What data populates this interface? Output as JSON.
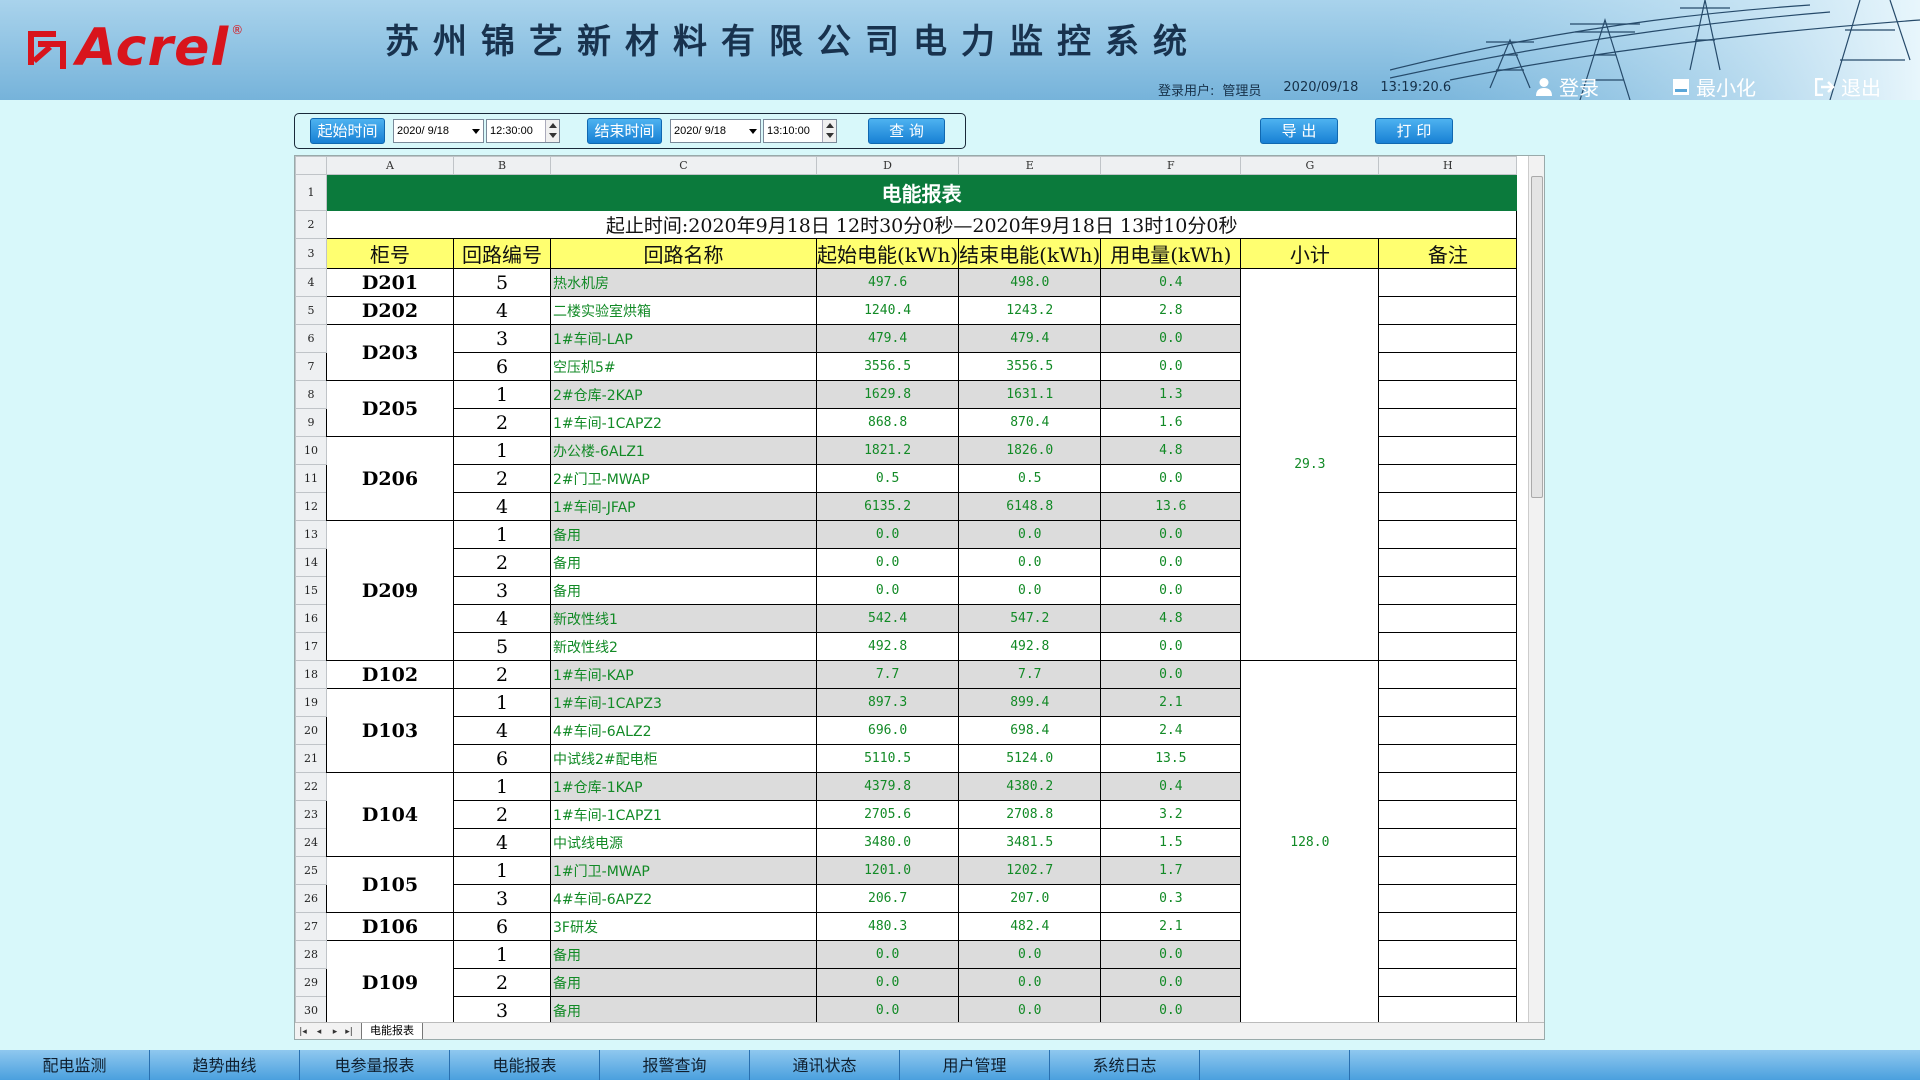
{
  "header": {
    "logo_text": "Acrel",
    "logo_reg": "®",
    "title": "苏州锦艺新材料有限公司电力监控系统",
    "user_label": "登录用户:",
    "user_name": "管理员",
    "date": "2020/09/18",
    "time": "13:19:20.6",
    "buttons": {
      "login": "登录",
      "minimize": "最小化",
      "exit": "退出"
    }
  },
  "filter": {
    "start_label": "起始时间",
    "start_date": "2020/ 9/18",
    "start_time": "12:30:00",
    "end_label": "结束时间",
    "end_date": "2020/ 9/18",
    "end_time": "13:10:00",
    "query": "查 询",
    "export": "导 出",
    "print": "打 印"
  },
  "sheet": {
    "columns": [
      "A",
      "B",
      "C",
      "D",
      "E",
      "F",
      "G",
      "H"
    ],
    "title": "电能报表",
    "time_range": "起止时间:2020年9月18日 12时30分0秒—2020年9月18日 13时10分0秒",
    "headers": [
      "柜号",
      "回路编号",
      "回路名称",
      "起始电能(kWh)",
      "结束电能(kWh)",
      "用电量(kWh)",
      "小计",
      "备注"
    ],
    "tab_name": "电能报表",
    "rows": [
      {
        "r": "4",
        "cab": "D201",
        "loop": "5",
        "name": "热水机房",
        "start": "497.6",
        "end": "498.0",
        "use": "0.4"
      },
      {
        "r": "5",
        "cab": "D202",
        "loop": "4",
        "name": "二楼实验室烘箱",
        "start": "1240.4",
        "end": "1243.2",
        "use": "2.8"
      },
      {
        "r": "6",
        "cab": "D203",
        "loop": "3",
        "name": "1#车间-LAP",
        "start": "479.4",
        "end": "479.4",
        "use": "0.0"
      },
      {
        "r": "7",
        "cab": "",
        "loop": "6",
        "name": "空压机5#",
        "start": "3556.5",
        "end": "3556.5",
        "use": "0.0"
      },
      {
        "r": "8",
        "cab": "D205",
        "loop": "1",
        "name": "2#仓库-2KAP",
        "start": "1629.8",
        "end": "1631.1",
        "use": "1.3"
      },
      {
        "r": "9",
        "cab": "",
        "loop": "2",
        "name": "1#车间-1CAPZ2",
        "start": "868.8",
        "end": "870.4",
        "use": "1.6"
      },
      {
        "r": "10",
        "cab": "D206",
        "loop": "1",
        "name": "办公楼-6ALZ1",
        "start": "1821.2",
        "end": "1826.0",
        "use": "4.8"
      },
      {
        "r": "11",
        "cab": "",
        "loop": "2",
        "name": "2#门卫-MWAP",
        "start": "0.5",
        "end": "0.5",
        "use": "0.0"
      },
      {
        "r": "12",
        "cab": "",
        "loop": "4",
        "name": "1#车间-JFAP",
        "start": "6135.2",
        "end": "6148.8",
        "use": "13.6"
      },
      {
        "r": "13",
        "cab": "D209",
        "loop": "1",
        "name": "备用",
        "start": "0.0",
        "end": "0.0",
        "use": "0.0"
      },
      {
        "r": "14",
        "cab": "",
        "loop": "2",
        "name": "备用",
        "start": "0.0",
        "end": "0.0",
        "use": "0.0"
      },
      {
        "r": "15",
        "cab": "",
        "loop": "3",
        "name": "备用",
        "start": "0.0",
        "end": "0.0",
        "use": "0.0"
      },
      {
        "r": "16",
        "cab": "",
        "loop": "4",
        "name": "新改性线1",
        "start": "542.4",
        "end": "547.2",
        "use": "4.8"
      },
      {
        "r": "17",
        "cab": "",
        "loop": "5",
        "name": "新改性线2",
        "start": "492.8",
        "end": "492.8",
        "use": "0.0"
      },
      {
        "r": "18",
        "cab": "D102",
        "loop": "2",
        "name": "1#车间-KAP",
        "start": "7.7",
        "end": "7.7",
        "use": "0.0"
      },
      {
        "r": "19",
        "cab": "D103",
        "loop": "1",
        "name": "1#车间-1CAPZ3",
        "start": "897.3",
        "end": "899.4",
        "use": "2.1"
      },
      {
        "r": "20",
        "cab": "",
        "loop": "4",
        "name": "4#车间-6ALZ2",
        "start": "696.0",
        "end": "698.4",
        "use": "2.4"
      },
      {
        "r": "21",
        "cab": "",
        "loop": "6",
        "name": "中试线2#配电柜",
        "start": "5110.5",
        "end": "5124.0",
        "use": "13.5"
      },
      {
        "r": "22",
        "cab": "D104",
        "loop": "1",
        "name": "1#仓库-1KAP",
        "start": "4379.8",
        "end": "4380.2",
        "use": "0.4"
      },
      {
        "r": "23",
        "cab": "",
        "loop": "2",
        "name": "1#车间-1CAPZ1",
        "start": "2705.6",
        "end": "2708.8",
        "use": "3.2"
      },
      {
        "r": "24",
        "cab": "",
        "loop": "4",
        "name": "中试线电源",
        "start": "3480.0",
        "end": "3481.5",
        "use": "1.5"
      },
      {
        "r": "25",
        "cab": "D105",
        "loop": "1",
        "name": "1#门卫-MWAP",
        "start": "1201.0",
        "end": "1202.7",
        "use": "1.7"
      },
      {
        "r": "26",
        "cab": "",
        "loop": "3",
        "name": "4#车间-6APZ2",
        "start": "206.7",
        "end": "207.0",
        "use": "0.3"
      },
      {
        "r": "27",
        "cab": "D106",
        "loop": "6",
        "name": "3F研发",
        "start": "480.3",
        "end": "482.4",
        "use": "2.1"
      },
      {
        "r": "28",
        "cab": "D109",
        "loop": "1",
        "name": "备用",
        "start": "0.0",
        "end": "0.0",
        "use": "0.0"
      },
      {
        "r": "29",
        "cab": "",
        "loop": "2",
        "name": "备用",
        "start": "0.0",
        "end": "0.0",
        "use": "0.0"
      },
      {
        "r": "30",
        "cab": "",
        "loop": "3",
        "name": "备用",
        "start": "0.0",
        "end": "0.0",
        "use": "0.0"
      }
    ],
    "subtotals": [
      "29.3",
      "128.0"
    ]
  },
  "nav": [
    "配电监测",
    "趋势曲线",
    "电参量报表",
    "电能报表",
    "报警查询",
    "通讯状态",
    "用户管理",
    "系统日志"
  ]
}
